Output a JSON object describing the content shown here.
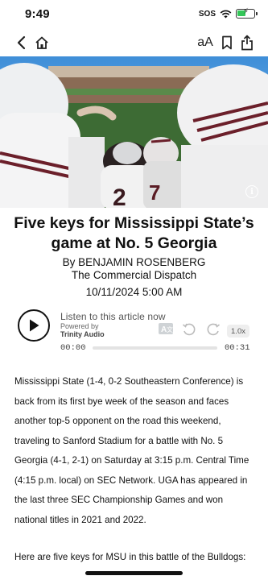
{
  "status_bar": {
    "time": "9:49",
    "carrier": "SOS"
  },
  "nav": {
    "text_size_label": "aA"
  },
  "article": {
    "headline": "Five keys for Mississippi State’s game at No. 5 Georgia",
    "byline": "By BENJAMIN ROSENBERG",
    "publication": "The Commercial Dispatch",
    "date": "10/11/2024 5:00 AM",
    "paragraphs": [
      "Mississippi State (1-4, 0-2 Southeastern Conference) is back from its first bye week of the season and faces another top-5 opponent on the road this weekend, traveling to Sanford Stadium for a battle with No. 5 Georgia (4-1, 2-1) on Saturday at 3:15 p.m. Central Time (4:15 p.m. local) on SEC Network. UGA has appeared in the last three SEC Championship Games and won national titles in 2021 and 2022.",
      "Here are five keys for MSU in this battle of the Bulldogs:"
    ]
  },
  "audio": {
    "listen_label": "Listen to this article now",
    "powered_by": "Powered by",
    "brand": "Trinity Audio",
    "speed": "1.0x",
    "current_time": "00:00",
    "total_time": "00:31",
    "progress": 0.0
  },
  "colors": {
    "battery": "#34c759",
    "jersey_maroon": "#6b1f2a"
  }
}
